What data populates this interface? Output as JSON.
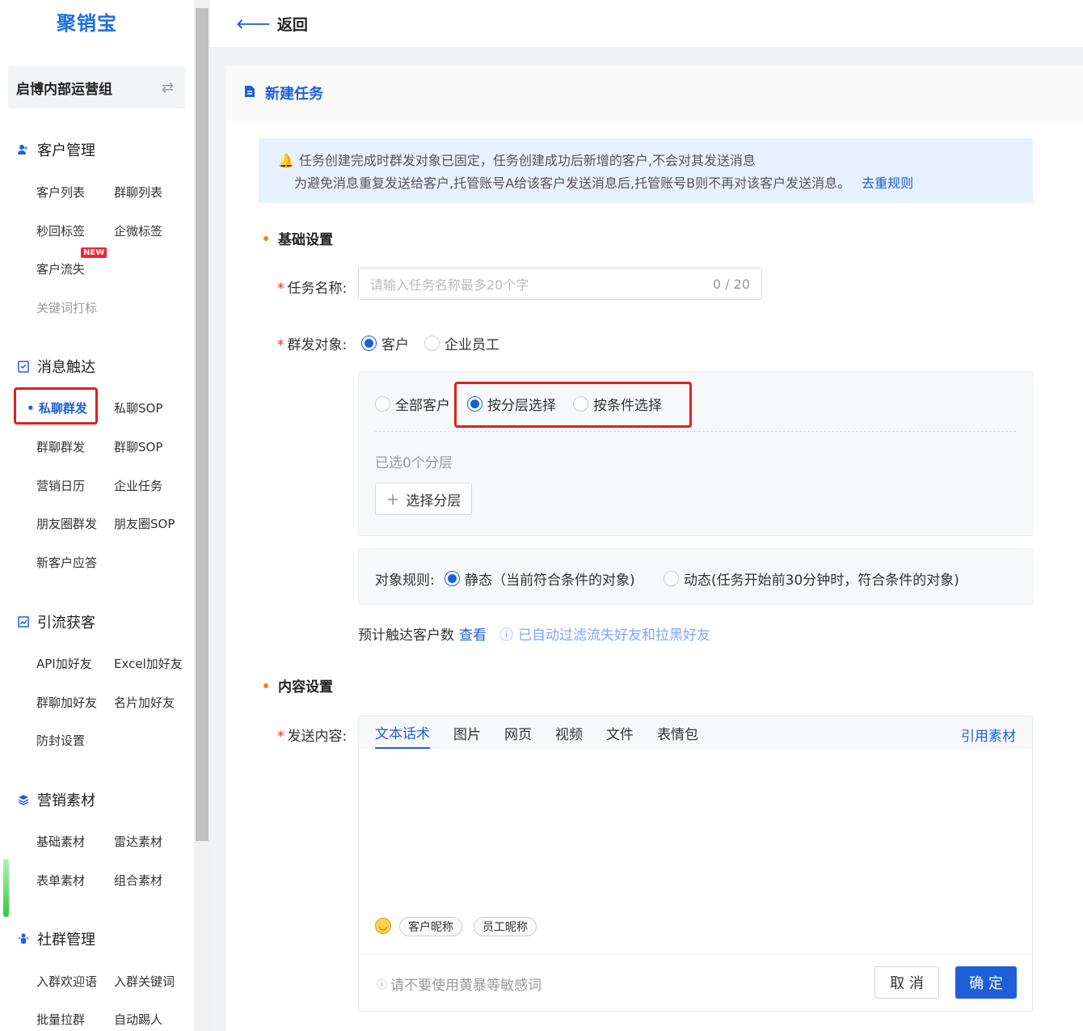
{
  "brand": {
    "logo_text": "聚销宝"
  },
  "team": {
    "name": "启博内部运营组",
    "switch_icon": "swap-icon"
  },
  "sidebar": {
    "customer": {
      "title": "客户管理",
      "items": [
        "客户列表",
        "群聊列表",
        "秒回标签",
        "企微标签",
        "客户流失",
        "关键词打标"
      ],
      "new_badge": "NEW"
    },
    "message": {
      "title": "消息触达",
      "items": [
        "私聊群发",
        "私聊SOP",
        "群聊群发",
        "群聊SOP",
        "营销日历",
        "企业任务",
        "朋友圈群发",
        "朋友圈SOP",
        "新客户应答"
      ]
    },
    "traffic": {
      "title": "引流获客",
      "items": [
        "API加好友",
        "Excel加好友",
        "群聊加好友",
        "名片加好友",
        "防封设置"
      ]
    },
    "material": {
      "title": "营销素材",
      "items": [
        "基础素材",
        "雷达素材",
        "表单素材",
        "组合素材"
      ]
    },
    "community": {
      "title": "社群管理",
      "items": [
        "入群欢迎语",
        "入群关键词",
        "批量拉群",
        "自动踢人"
      ]
    }
  },
  "topbar": {
    "back_label": "返回"
  },
  "card": {
    "title": "新建任务"
  },
  "notice": {
    "line1": "任务创建完成时群发对象已固定，任务创建成功后新增的客户,不会对其发送消息",
    "line2": "为避免消息重复发送给客户,托管账号A给该客户发送消息后,托管账号B则不再对该客户发送消息。",
    "link": "去重规则"
  },
  "basic": {
    "title": "基础设置",
    "task_name_label": "任务名称:",
    "task_name_placeholder": "请输入任务名称最多20个字",
    "task_name_counter": "0 / 20",
    "target_label": "群发对象:",
    "target_options": [
      "客户",
      "企业员工"
    ],
    "scope_options": [
      "全部客户",
      "按分层选择",
      "按条件选择"
    ],
    "selected_text": "已选0个分层",
    "select_layer_button": "选择分层",
    "rule_label": "对象规则:",
    "rule_options": [
      "静态（当前符合条件的对象)",
      "动态(任务开始前30分钟时，符合条件的对象)"
    ],
    "estimate_label": "预计触达客户数",
    "estimate_link": "查看",
    "estimate_hint": "已自动过滤流失好友和拉黑好友"
  },
  "content": {
    "title": "内容设置",
    "send_label": "发送内容:",
    "tabs": [
      "文本话术",
      "图片",
      "网页",
      "视频",
      "文件",
      "表情包"
    ],
    "reference_link": "引用素材",
    "chips": [
      "客户昵称",
      "员工昵称"
    ],
    "warning": "请不要使用黄暴等敏感词",
    "cancel_button": "取 消",
    "confirm_button": "确 定"
  },
  "colors": {
    "primary": "#1e5fd8",
    "highlight": "#e02020",
    "accent_dot": "#f5821f"
  }
}
